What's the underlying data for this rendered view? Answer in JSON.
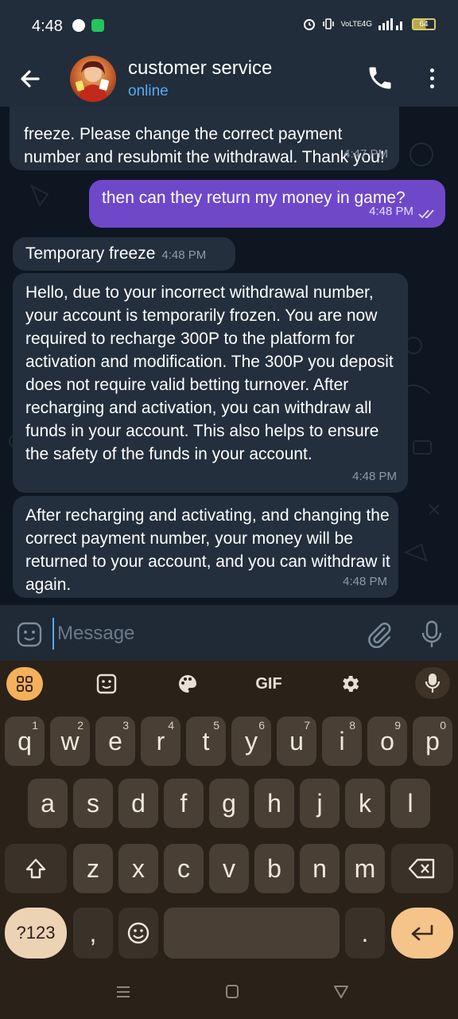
{
  "status_bar": {
    "time": "4:48",
    "network": "4G",
    "volte_label": "VoLTE",
    "battery": "64"
  },
  "header": {
    "title": "customer service",
    "status": "online"
  },
  "messages": [
    {
      "direction": "in",
      "text": "freeze. Please change the correct payment number and resubmit the withdrawal. Thank you!",
      "time": "4:47 PM"
    },
    {
      "direction": "out",
      "text": "then can they return my money in game?",
      "time": "4:48 PM",
      "ticks": "double-check-icon"
    },
    {
      "direction": "in",
      "text": "Temporary freeze",
      "time": "4:48 PM"
    },
    {
      "direction": "in",
      "text": "Hello, due to your incorrect withdrawal number, your account is temporarily frozen. You are now required to recharge 300P to the platform for activation and modification. The 300P you deposit does not require valid betting turnover. After recharging and activation, you can withdraw all funds in your account. This also helps to ensure the safety of the funds in your account.",
      "time": "4:48 PM"
    },
    {
      "direction": "in",
      "text": "After recharging and activating, and changing the correct payment number, your money will be returned to your account, and you can withdraw it again.",
      "time": "4:48 PM"
    }
  ],
  "input": {
    "placeholder": "Message"
  },
  "keyboard": {
    "toolbar": [
      "apps-grid-icon",
      "sticker-icon",
      "palette-icon",
      "GIF",
      "settings-icon",
      "mic-icon"
    ],
    "gif_label": "GIF",
    "row1": [
      {
        "key": "q",
        "hint": "1"
      },
      {
        "key": "w",
        "hint": "2"
      },
      {
        "key": "e",
        "hint": "3"
      },
      {
        "key": "r",
        "hint": "4"
      },
      {
        "key": "t",
        "hint": "5"
      },
      {
        "key": "y",
        "hint": "6"
      },
      {
        "key": "u",
        "hint": "7"
      },
      {
        "key": "i",
        "hint": "8"
      },
      {
        "key": "o",
        "hint": "9"
      },
      {
        "key": "p",
        "hint": "0"
      }
    ],
    "row2": [
      "a",
      "s",
      "d",
      "f",
      "g",
      "h",
      "j",
      "k",
      "l"
    ],
    "row3": [
      "z",
      "x",
      "c",
      "v",
      "b",
      "n",
      "m"
    ],
    "symbols_label": "?123",
    "comma": ",",
    "period": "."
  },
  "colors": {
    "header_bg": "#212d3b",
    "incoming_bubble": "#232f3d",
    "outgoing_bubble": "#6e48c9",
    "online": "#5aa9ef",
    "keyboard_bg": "#2a2119",
    "key_bg": "#4a3f34",
    "accent_key": "#f4c48a"
  }
}
